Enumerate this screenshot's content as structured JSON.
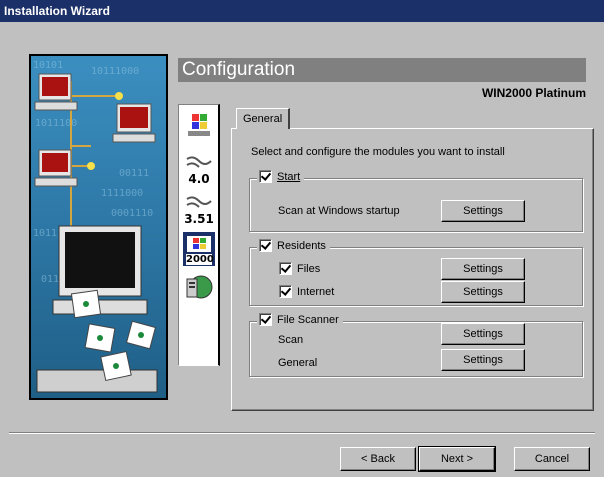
{
  "window": {
    "title": "Installation Wizard"
  },
  "header": {
    "title": "Configuration",
    "product": "WIN2000 Platinum"
  },
  "os_icons": [
    {
      "name": "windows-98-icon",
      "label": ""
    },
    {
      "name": "windows-nt-4-icon",
      "label": "4.0"
    },
    {
      "name": "windows-nt-351-icon",
      "label": "3.51"
    },
    {
      "name": "windows-2000-icon",
      "label": "2000"
    },
    {
      "name": "network-icon",
      "label": ""
    }
  ],
  "tab": {
    "label": "General"
  },
  "panel": {
    "description": "Select and configure the modules you want to install",
    "start": {
      "label": "Start",
      "checked": true,
      "row_label": "Scan at Windows startup",
      "settings_label": "Settings"
    },
    "residents": {
      "label": "Residents",
      "checked": true,
      "files": {
        "label": "Files",
        "checked": true,
        "settings_label": "Settings"
      },
      "internet": {
        "label": "Internet",
        "checked": true,
        "settings_label": "Settings"
      }
    },
    "file_scanner": {
      "label": "File Scanner",
      "checked": true,
      "scan": {
        "label": "Scan",
        "settings_label": "Settings"
      },
      "general": {
        "label": "General",
        "settings_label": "Settings"
      }
    }
  },
  "footer": {
    "back_label": "< Back",
    "next_label": "Next >",
    "cancel_label": "Cancel"
  },
  "colors": {
    "titlebar": "#1b2f68",
    "dialog": "#c0c0c0",
    "header_bar": "#808080",
    "art_background": "#2a7ba8"
  }
}
